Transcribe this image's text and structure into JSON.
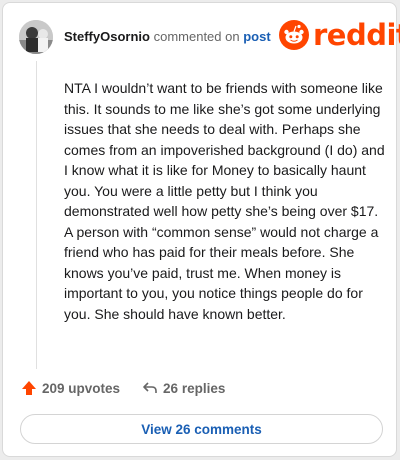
{
  "header": {
    "username": "SteffyOsornio",
    "action_text": "commented on",
    "post_link": "post",
    "logo_text": "reddit"
  },
  "comment": {
    "body": "NTA I wouldn’t want to be friends with someone like this. It sounds to me like she’s got some underlying issues that she needs to deal with. Perhaps she comes from an impoverished background (I do) and I know what it is like for Money to basically haunt you. You were a little petty but I think you demonstrated well how petty she’s being over $17. A person with “common sense” would not charge a friend who has paid for their meals before. She knows you’ve paid, trust me. When money is important to you, you notice things people do for you. She should have known better."
  },
  "actions": {
    "upvotes": "209 upvotes",
    "replies": "26 replies",
    "view_comments": "View 26 comments"
  },
  "colors": {
    "brand": "#ff4500",
    "link": "#1a5fb4",
    "muted": "#666666"
  }
}
